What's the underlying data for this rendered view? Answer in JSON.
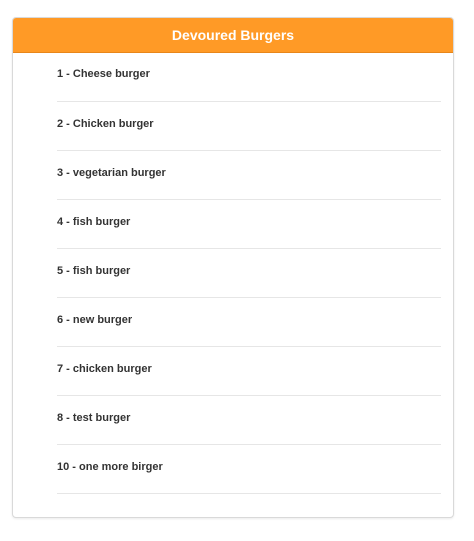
{
  "panel": {
    "title": "Devoured Burgers",
    "accent_color": "#ff9a26"
  },
  "items": [
    {
      "label": "1 - Cheese burger"
    },
    {
      "label": "2 - Chicken burger"
    },
    {
      "label": "3 - vegetarian burger"
    },
    {
      "label": "4 - fish burger"
    },
    {
      "label": "5 - fish burger"
    },
    {
      "label": "6 - new burger"
    },
    {
      "label": "7 - chicken burger"
    },
    {
      "label": "8 - test burger"
    },
    {
      "label": "10 - one more birger"
    }
  ]
}
